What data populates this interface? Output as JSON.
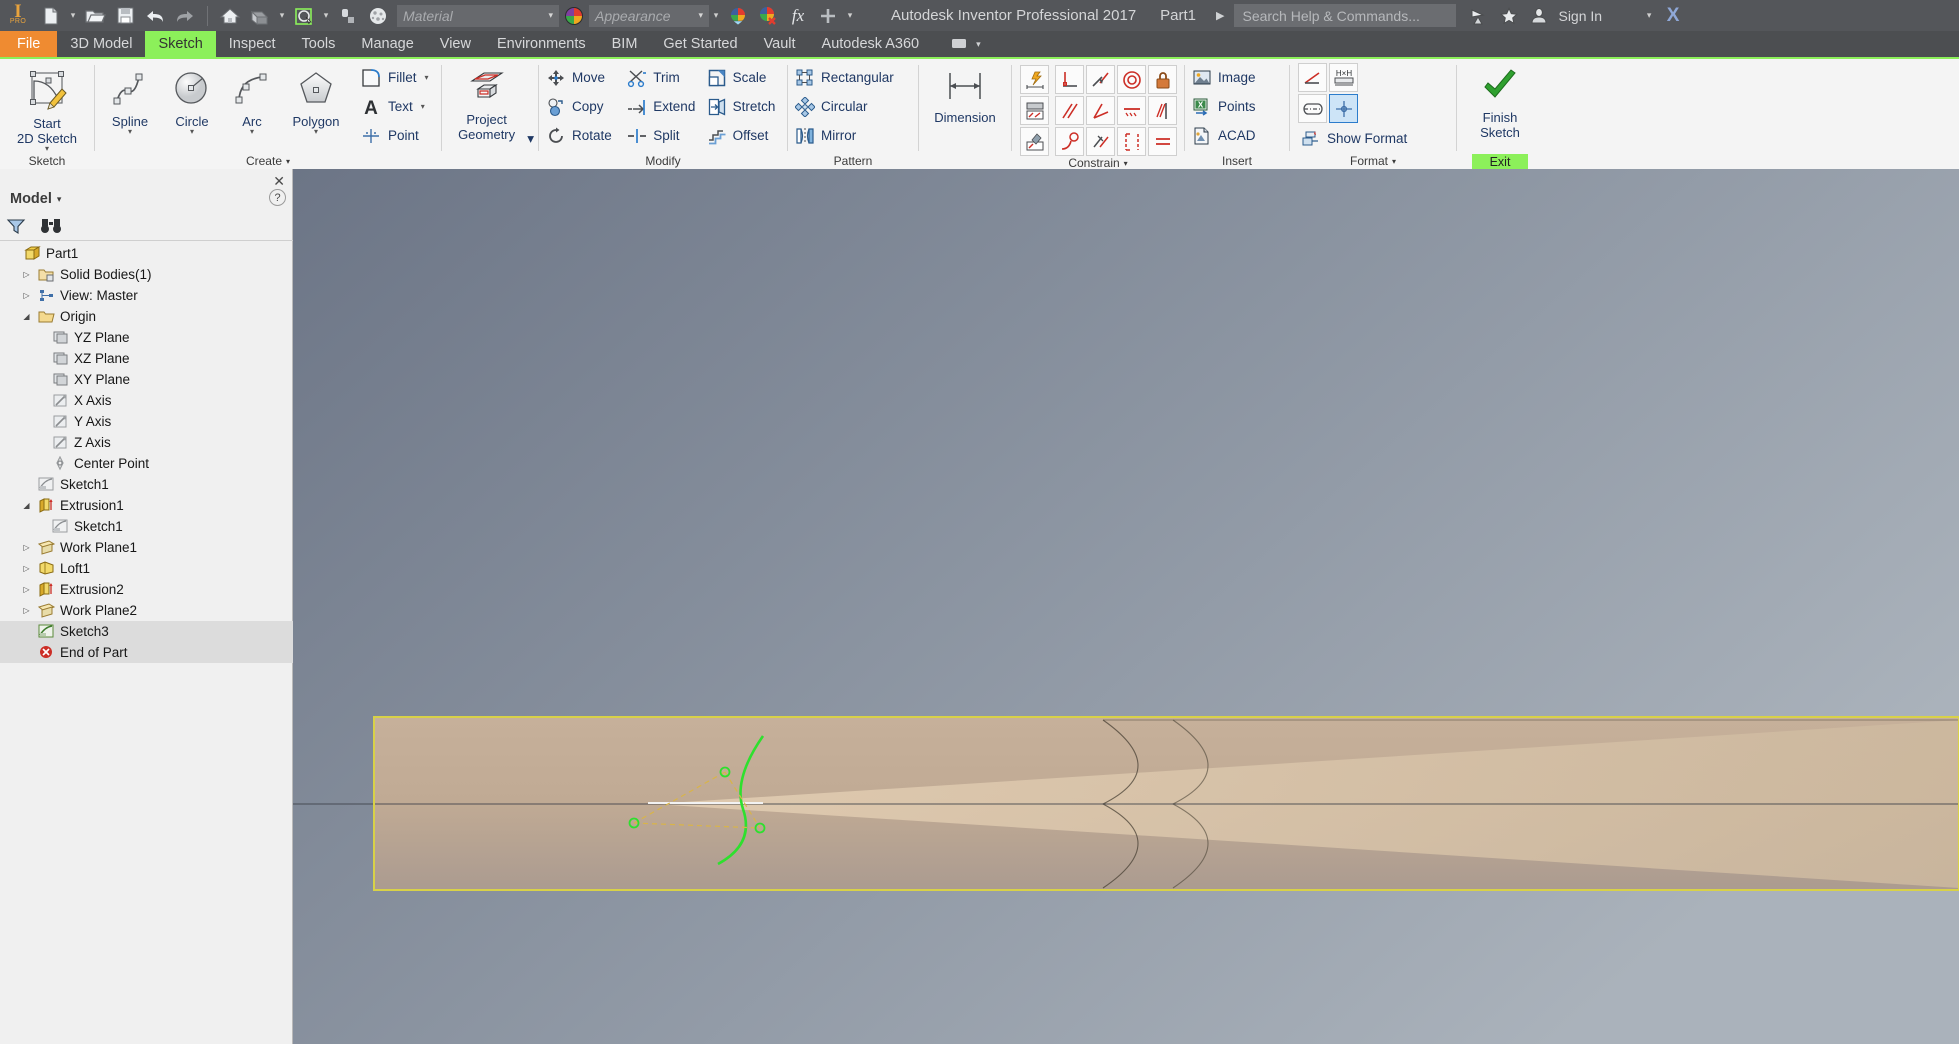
{
  "titlebar": {
    "logo_text": "I",
    "logo_sub": "PRO",
    "buttons": [
      {
        "name": "new-document-button",
        "icon": "new-document-icon"
      },
      {
        "name": "open-button",
        "icon": "open-folder-icon"
      },
      {
        "name": "save-button",
        "icon": "save-disk-icon"
      },
      {
        "name": "undo-button",
        "icon": "undo-arrow-icon"
      },
      {
        "name": "redo-button",
        "icon": "redo-arrow-icon"
      },
      {
        "name": "home-button",
        "icon": "home-icon"
      },
      {
        "name": "return-button",
        "icon": "return-icon"
      },
      {
        "name": "sketch-visibility-button",
        "icon": "sketch-visibility-icon"
      },
      {
        "name": "component-button",
        "icon": "component-icon"
      },
      {
        "name": "material-sphere-button",
        "icon": "material-sphere-icon"
      }
    ],
    "material_placeholder": "Material",
    "appearance_placeholder": "Appearance",
    "app_title": "Autodesk Inventor Professional 2017",
    "document_name": "Part1",
    "search_placeholder": "Search Help & Commands...",
    "sign_in_label": "Sign In",
    "close_glyph": "X",
    "fx_label": "fx"
  },
  "tabs": [
    {
      "label": "File",
      "state": "file"
    },
    {
      "label": "3D Model",
      "state": "normal"
    },
    {
      "label": "Sketch",
      "state": "active"
    },
    {
      "label": "Inspect",
      "state": "normal"
    },
    {
      "label": "Tools",
      "state": "normal"
    },
    {
      "label": "Manage",
      "state": "normal"
    },
    {
      "label": "View",
      "state": "normal"
    },
    {
      "label": "Environments",
      "state": "normal"
    },
    {
      "label": "BIM",
      "state": "normal"
    },
    {
      "label": "Get Started",
      "state": "normal"
    },
    {
      "label": "Vault",
      "state": "normal"
    },
    {
      "label": "Autodesk A360",
      "state": "normal"
    }
  ],
  "ribbon": {
    "panels": [
      {
        "name": "sketch",
        "label": "Sketch",
        "big": [
          {
            "name": "start-2d-sketch-button",
            "line1": "Start",
            "line2": "2D Sketch",
            "icon": "start-2d-sketch-icon"
          }
        ]
      },
      {
        "name": "create",
        "label": "Create",
        "big": [
          {
            "name": "spline-button",
            "line1": "Spline",
            "line2": "",
            "icon": "spline-icon"
          },
          {
            "name": "circle-button",
            "line1": "Circle",
            "line2": "",
            "icon": "circle-icon"
          },
          {
            "name": "arc-button",
            "line1": "Arc",
            "line2": "",
            "icon": "arc-icon"
          },
          {
            "name": "polygon-button",
            "line1": "Polygon",
            "line2": "",
            "icon": "polygon-icon"
          }
        ],
        "small": [
          {
            "name": "fillet-button",
            "label": "Fillet",
            "icon": "fillet-icon",
            "caret": true
          },
          {
            "name": "text-button",
            "label": "Text",
            "icon": "text-icon",
            "caret": true
          },
          {
            "name": "point-button",
            "label": "Point",
            "icon": "point-icon",
            "caret": false
          }
        ]
      },
      {
        "name": "project-geometry",
        "label": "",
        "big": [
          {
            "name": "project-geometry-button",
            "line1": "Project",
            "line2": "Geometry",
            "icon": "project-geometry-icon"
          }
        ]
      },
      {
        "name": "modify",
        "label": "Modify",
        "columns": [
          [
            {
              "name": "move-button",
              "label": "Move",
              "icon": "move-icon"
            },
            {
              "name": "copy-button",
              "label": "Copy",
              "icon": "copy-icon"
            },
            {
              "name": "rotate-button",
              "label": "Rotate",
              "icon": "rotate-icon"
            }
          ],
          [
            {
              "name": "trim-button",
              "label": "Trim",
              "icon": "trim-scissors-icon"
            },
            {
              "name": "extend-button",
              "label": "Extend",
              "icon": "extend-icon"
            },
            {
              "name": "split-button",
              "label": "Split",
              "icon": "split-icon"
            }
          ],
          [
            {
              "name": "scale-button",
              "label": "Scale",
              "icon": "scale-icon"
            },
            {
              "name": "stretch-button",
              "label": "Stretch",
              "icon": "stretch-icon"
            },
            {
              "name": "offset-button",
              "label": "Offset",
              "icon": "offset-icon"
            }
          ]
        ]
      },
      {
        "name": "pattern",
        "label": "Pattern",
        "columns": [
          [
            {
              "name": "rectangular-pattern-button",
              "label": "Rectangular",
              "icon": "rectangular-pattern-icon"
            },
            {
              "name": "circular-pattern-button",
              "label": "Circular",
              "icon": "circular-pattern-icon"
            },
            {
              "name": "mirror-button",
              "label": "Mirror",
              "icon": "mirror-icon"
            }
          ]
        ]
      },
      {
        "name": "dimension",
        "label": "",
        "big": [
          {
            "name": "dimension-button",
            "line1": "Dimension",
            "line2": "",
            "icon": "dimension-icon"
          }
        ]
      },
      {
        "name": "constrain",
        "label": "Constrain",
        "left_buttons": [
          {
            "name": "auto-dimension-button",
            "icon": "auto-dimension-icon"
          },
          {
            "name": "show-constraints-button",
            "icon": "show-constraints-icon"
          },
          {
            "name": "constraint-settings-button",
            "icon": "constraint-settings-icon"
          }
        ],
        "grid": [
          [
            {
              "name": "perpendicular-constraint-button",
              "icon": "perpendicular-icon"
            },
            {
              "name": "tangent-constraint-button",
              "icon": "tangent-icon"
            },
            {
              "name": "concentric-constraint-button",
              "icon": "concentric-icon"
            },
            {
              "name": "fix-constraint-button",
              "icon": "fix-lock-icon"
            }
          ],
          [
            {
              "name": "parallel-constraint-button",
              "icon": "parallel-icon"
            },
            {
              "name": "coincident-constraint-button",
              "icon": "coincident-icon"
            },
            {
              "name": "collinear-constraint-button",
              "icon": "collinear-icon"
            },
            {
              "name": "equal-constraint-button",
              "icon": "equal-icon"
            }
          ],
          [
            {
              "name": "smooth-constraint-button",
              "icon": "smooth-icon"
            },
            {
              "name": "symmetric-constraint-button",
              "icon": "symmetric-icon"
            },
            {
              "name": "horizontal-constraint-button",
              "icon": "horizontal-icon"
            },
            {
              "name": "vertical-constraint-button",
              "icon": "vertical-icon"
            }
          ]
        ]
      },
      {
        "name": "insert",
        "label": "Insert",
        "small": [
          {
            "name": "image-button",
            "label": "Image",
            "icon": "image-icon"
          },
          {
            "name": "points-button",
            "label": "Points",
            "icon": "points-excel-icon"
          },
          {
            "name": "acad-button",
            "label": "ACAD",
            "icon": "acad-icon"
          }
        ]
      },
      {
        "name": "format",
        "label": "Format",
        "grid": [
          [
            {
              "name": "construction-format-button",
              "icon": "construction-line-icon"
            },
            {
              "name": "driven-dimension-button",
              "icon": "driven-dimension-icon"
            }
          ],
          [
            {
              "name": "centerline-button",
              "icon": "centerline-icon"
            },
            {
              "name": "center-point-button",
              "icon": "center-point-icon",
              "selected": true
            }
          ]
        ],
        "small": [
          {
            "name": "show-format-button",
            "label": "Show Format",
            "icon": "show-format-icon"
          }
        ]
      },
      {
        "name": "exit",
        "label": "",
        "big": [
          {
            "name": "finish-sketch-button",
            "line1": "Finish",
            "line2": "Sketch",
            "icon": "green-check-icon"
          }
        ],
        "exit_label": "Exit"
      }
    ]
  },
  "browser": {
    "title": "Model",
    "help_glyph": "?",
    "close_glyph": "✕",
    "tools": [
      {
        "name": "filter-icon"
      },
      {
        "name": "find-binoculars-icon"
      }
    ],
    "tree": [
      {
        "label": "Part1",
        "indent": 0,
        "arrow": "none",
        "icon": "part-cube-icon",
        "selected": false
      },
      {
        "label": "Solid Bodies(1)",
        "indent": 1,
        "arrow": "collapsed",
        "icon": "solid-bodies-icon",
        "selected": false
      },
      {
        "label": "View: Master",
        "indent": 1,
        "arrow": "collapsed",
        "icon": "view-master-icon",
        "selected": false
      },
      {
        "label": "Origin",
        "indent": 1,
        "arrow": "expanded",
        "icon": "origin-folder-icon",
        "selected": false
      },
      {
        "label": "YZ Plane",
        "indent": 2,
        "arrow": "none",
        "icon": "plane-icon",
        "selected": false
      },
      {
        "label": "XZ Plane",
        "indent": 2,
        "arrow": "none",
        "icon": "plane-icon",
        "selected": false
      },
      {
        "label": "XY Plane",
        "indent": 2,
        "arrow": "none",
        "icon": "plane-icon",
        "selected": false
      },
      {
        "label": "X Axis",
        "indent": 2,
        "arrow": "none",
        "icon": "axis-icon",
        "selected": false
      },
      {
        "label": "Y Axis",
        "indent": 2,
        "arrow": "none",
        "icon": "axis-icon",
        "selected": false
      },
      {
        "label": "Z Axis",
        "indent": 2,
        "arrow": "none",
        "icon": "axis-icon",
        "selected": false
      },
      {
        "label": "Center Point",
        "indent": 2,
        "arrow": "none",
        "icon": "center-point-icon",
        "selected": false
      },
      {
        "label": "Sketch1",
        "indent": 1,
        "arrow": "none",
        "icon": "sketch-icon",
        "selected": false
      },
      {
        "label": "Extrusion1",
        "indent": 1,
        "arrow": "expanded",
        "icon": "extrusion-icon",
        "selected": false
      },
      {
        "label": "Sketch1",
        "indent": 2,
        "arrow": "none",
        "icon": "sketch-icon",
        "selected": false
      },
      {
        "label": "Work Plane1",
        "indent": 1,
        "arrow": "collapsed",
        "icon": "work-plane-icon",
        "selected": false
      },
      {
        "label": "Loft1",
        "indent": 1,
        "arrow": "collapsed",
        "icon": "loft-icon",
        "selected": false
      },
      {
        "label": "Extrusion2",
        "indent": 1,
        "arrow": "collapsed",
        "icon": "extrusion-icon",
        "selected": false
      },
      {
        "label": "Work Plane2",
        "indent": 1,
        "arrow": "collapsed",
        "icon": "work-plane-icon",
        "selected": false
      },
      {
        "label": "Sketch3",
        "indent": 1,
        "arrow": "none",
        "icon": "sketch-active-icon",
        "selected": true
      },
      {
        "label": "End of Part",
        "indent": 1,
        "arrow": "none",
        "icon": "end-of-part-icon",
        "selected": true
      }
    ]
  },
  "viewport": {
    "name": "3d-graphics-viewport",
    "background_top": "#7c8492",
    "background_bottom": "#9aa3ad",
    "sketch_highlight_color": "#d8d148",
    "active_sketch_curve_color": "#2ee02e",
    "construction_color": "#d8b44a",
    "model_face_light": "#cbb49c",
    "model_face_dark": "#b0a096"
  },
  "colors": {
    "accent_orange": "#ef8b31",
    "accent_green": "#8cf05a",
    "titlebar_bg": "#54565a",
    "tabbar_bg": "#4c4e51",
    "ribbon_bg": "#f4f4f4",
    "browser_bg": "#f0f0f0",
    "text_blue": "#1f3864"
  }
}
